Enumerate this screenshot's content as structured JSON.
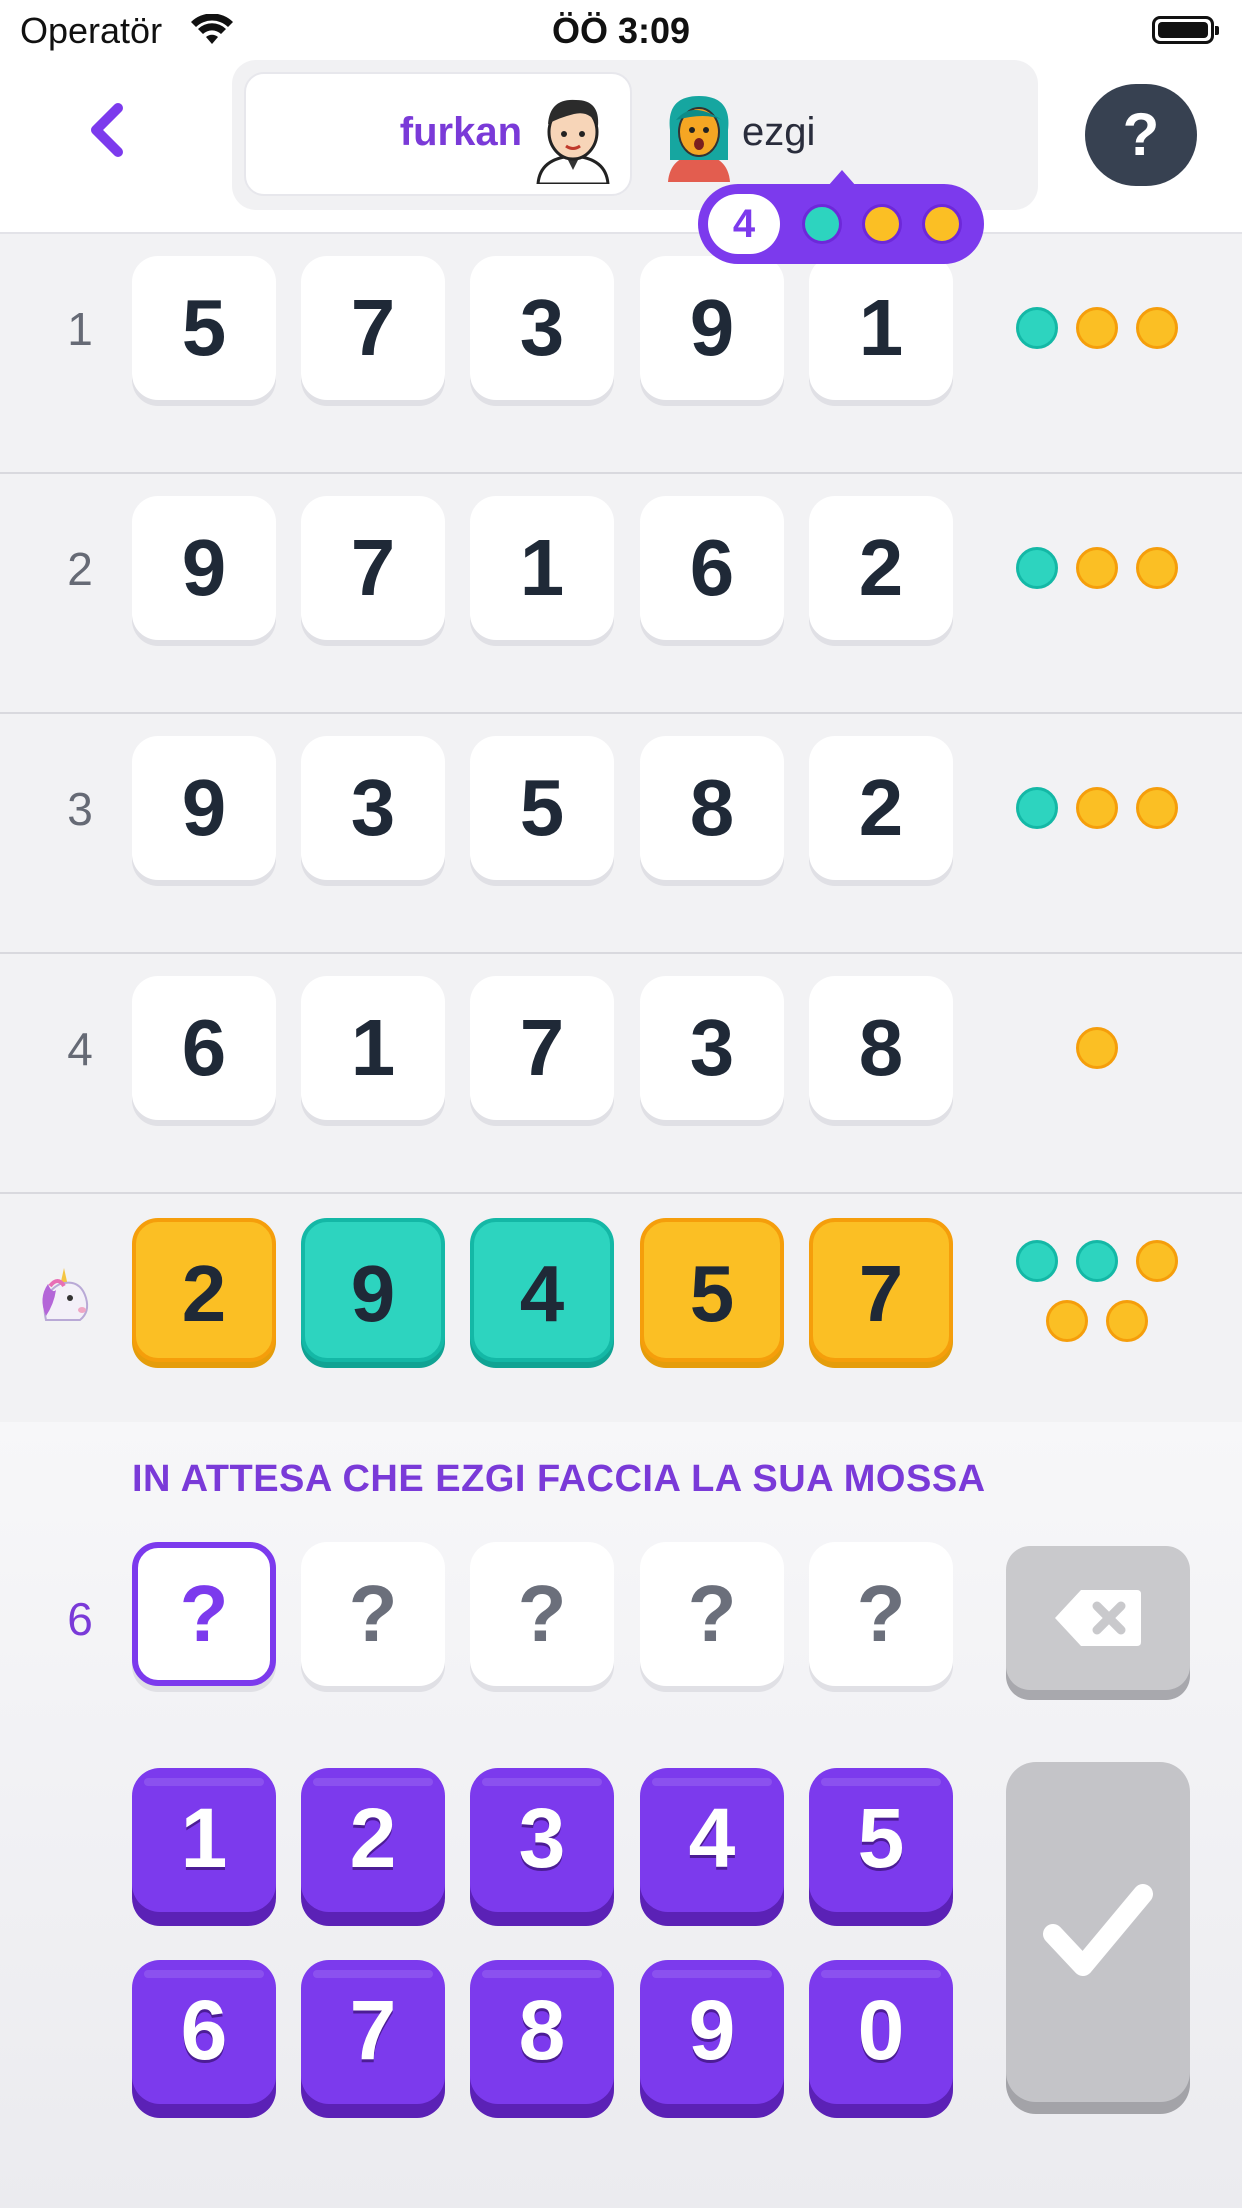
{
  "status_bar": {
    "carrier": "Operatör",
    "time": "ÖÖ 3:09"
  },
  "header": {
    "player_active": "furkan",
    "player_opponent": "ezgi",
    "help_label": "?"
  },
  "opponent_badge": {
    "count": "4",
    "dots": [
      "teal",
      "orange",
      "orange"
    ]
  },
  "rows": [
    {
      "number": "1",
      "digits": [
        "5",
        "7",
        "3",
        "9",
        "1"
      ],
      "feedback": [
        "teal",
        "orange",
        "orange"
      ]
    },
    {
      "number": "2",
      "digits": [
        "9",
        "7",
        "1",
        "6",
        "2"
      ],
      "feedback": [
        "teal",
        "orange",
        "orange"
      ]
    },
    {
      "number": "3",
      "digits": [
        "9",
        "3",
        "5",
        "8",
        "2"
      ],
      "feedback": [
        "teal",
        "orange",
        "orange"
      ]
    },
    {
      "number": "4",
      "digits": [
        "6",
        "1",
        "7",
        "3",
        "8"
      ],
      "feedback": [
        "orange"
      ]
    }
  ],
  "opponent_row": {
    "icon": "unicorn-icon",
    "digits": [
      "2",
      "9",
      "4",
      "5",
      "7"
    ],
    "digit_colors": [
      "orange",
      "teal",
      "teal",
      "orange",
      "orange"
    ],
    "feedback": [
      "teal",
      "teal",
      "orange",
      "orange",
      "orange"
    ]
  },
  "status_message": "IN ATTESA CHE EZGI FACCIA LA SUA MOSSA",
  "input": {
    "number": "6",
    "slots": [
      "?",
      "?",
      "?",
      "?",
      "?"
    ]
  },
  "keypad": [
    "1",
    "2",
    "3",
    "4",
    "5",
    "6",
    "7",
    "8",
    "9",
    "0"
  ],
  "colors": {
    "accent": "#7c3aed",
    "teal": "#2dd4bf",
    "orange": "#fbbf24"
  }
}
